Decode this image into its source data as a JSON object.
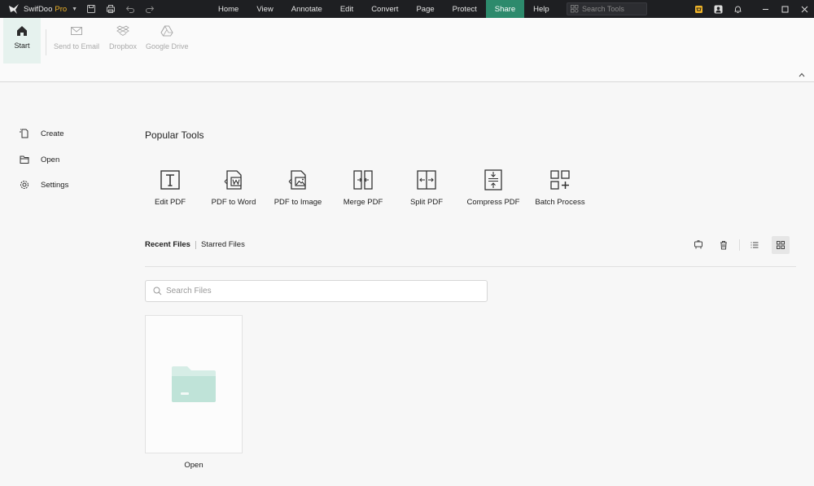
{
  "app": {
    "brand": "SwifDoo",
    "edition": "Pro"
  },
  "menu": [
    "Home",
    "View",
    "Annotate",
    "Edit",
    "Convert",
    "Page",
    "Protect",
    "Share",
    "Help"
  ],
  "active_menu": "Share",
  "search_tools": {
    "placeholder": "Search Tools"
  },
  "ribbon": {
    "start": "Start",
    "items": [
      "Send to Email",
      "Dropbox",
      "Google Drive"
    ]
  },
  "sidebar": {
    "items": [
      "Create",
      "Open",
      "Settings"
    ]
  },
  "popular_tools": {
    "title": "Popular Tools",
    "items": [
      "Edit PDF",
      "PDF to Word",
      "PDF to Image",
      "Merge PDF",
      "Split PDF",
      "Compress PDF",
      "Batch Process"
    ]
  },
  "files": {
    "tabs": [
      "Recent Files",
      "Starred Files"
    ],
    "active_tab": "Recent Files",
    "search_placeholder": "Search Files",
    "open_card_label": "Open"
  },
  "colors": {
    "accent": "#2d8a6c",
    "titlebar": "#1e1f22",
    "folder": "#bfe3d8",
    "pro": "#f0b429"
  }
}
